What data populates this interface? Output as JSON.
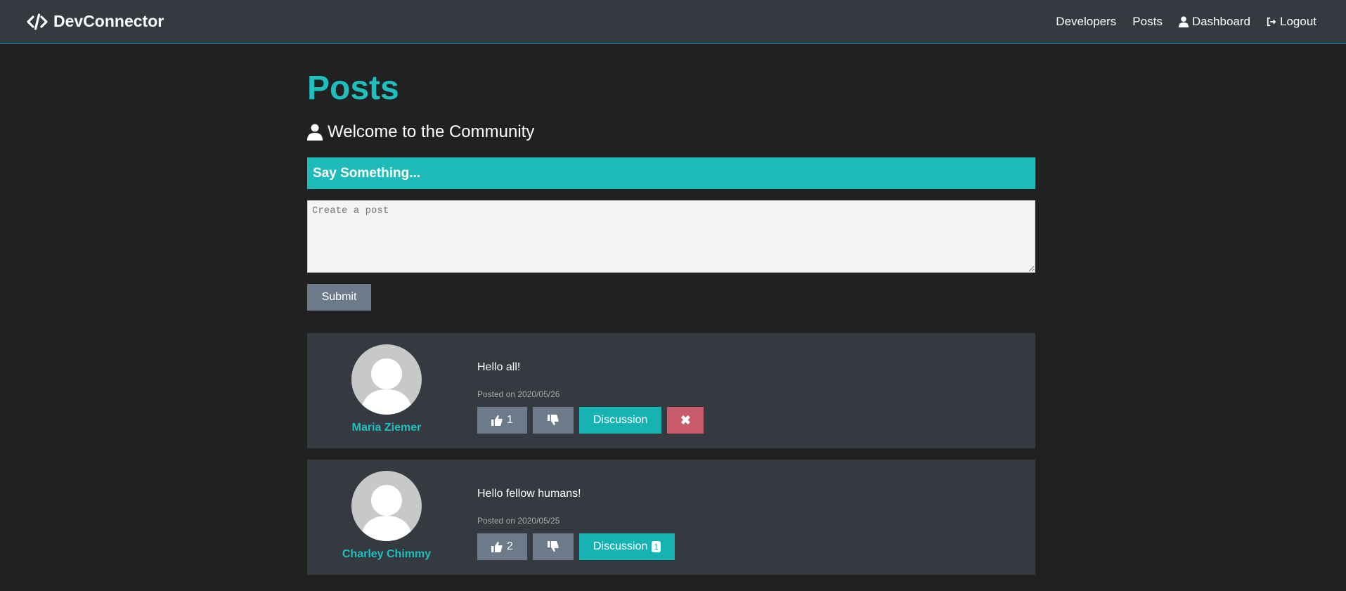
{
  "navbar": {
    "brand": "DevConnector",
    "links": {
      "developers": "Developers",
      "posts": "Posts",
      "dashboard": "Dashboard",
      "logout": "Logout"
    }
  },
  "page": {
    "title": "Posts",
    "lead": "Welcome to the Community"
  },
  "post_form": {
    "header": "Say Something...",
    "placeholder": "Create a post",
    "submit_label": "Submit"
  },
  "posts": [
    {
      "user_name": "Maria Ziemer",
      "text": "Hello all!",
      "date": "Posted on 2020/05/26",
      "likes": "1",
      "discussion_label": "Discussion",
      "comment_count": "",
      "delete_label": "✖"
    },
    {
      "user_name": "Charley Chimmy",
      "text": "Hello fellow humans!",
      "date": "Posted on 2020/05/25",
      "likes": "2",
      "discussion_label": "Discussion",
      "comment_count": "1"
    }
  ],
  "colors": {
    "accent": "#17a2b8",
    "background": "#212121",
    "card": "#343a40",
    "danger": "#c85a6a",
    "secondary": "#6c7a89"
  },
  "icons": [
    "code-icon",
    "user-icon",
    "sign-out-icon",
    "thumbs-up-icon",
    "thumbs-down-icon",
    "times-icon"
  ]
}
